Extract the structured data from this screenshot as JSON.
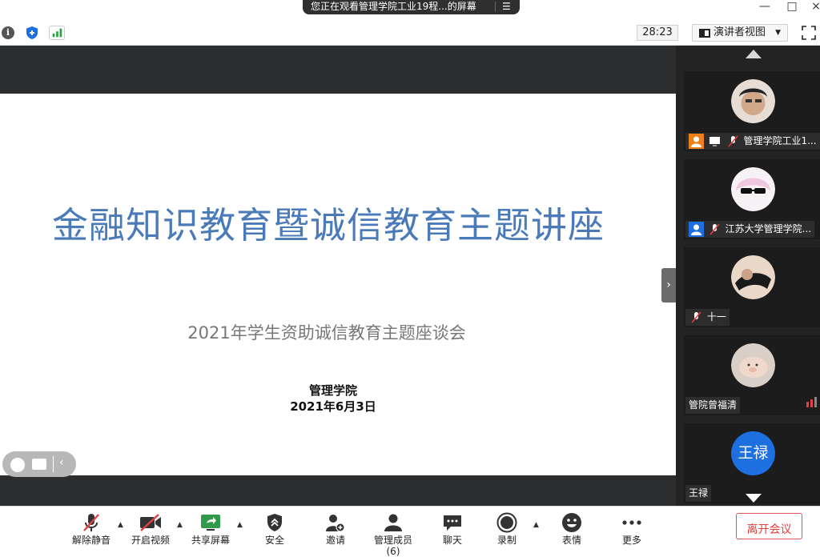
{
  "window": {
    "share_notice": "您正在观看管理学院工业19程...的屏幕",
    "controls": [
      "—",
      "□",
      "×"
    ]
  },
  "top_toolbar": {
    "timer": "28:23",
    "view_button": "演讲者视图"
  },
  "slide": {
    "title": "金融知识教育暨诚信教育主题讲座",
    "subtitle": "2021年学生资助诚信教育主题座谈会",
    "org": "管理学院",
    "date": "2021年6月3日"
  },
  "participants": [
    {
      "name": "管理学院工业1...",
      "avatar": "photo-man"
    },
    {
      "name": "江苏大学管理学院...",
      "avatar": "anime-sunglasses"
    },
    {
      "name": "十一",
      "avatar": "photo-person-lying"
    },
    {
      "name": "管院曾福清",
      "avatar": "photo-pig"
    },
    {
      "name": "王禄",
      "avatar_text": "王禄",
      "avatar_color": "#1e6fe0"
    }
  ],
  "bottom_toolbar": {
    "buttons": [
      {
        "label": "解除静音"
      },
      {
        "label": "开启视频"
      },
      {
        "label": "共享屏幕"
      },
      {
        "label": "安全"
      },
      {
        "label": "邀请"
      },
      {
        "label": "管理成员(6)"
      },
      {
        "label": "聊天"
      },
      {
        "label": "录制"
      },
      {
        "label": "表情"
      },
      {
        "label": "更多"
      }
    ],
    "leave": "离开会议"
  },
  "colors": {
    "title_blue": "#4a7ab8",
    "leave_red": "#e04040",
    "host_orange": "#f07f1a",
    "cohost_blue": "#1e6fe0",
    "share_green": "#2e9a4a"
  }
}
